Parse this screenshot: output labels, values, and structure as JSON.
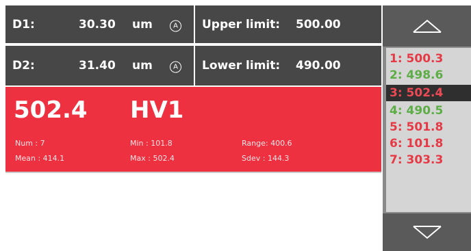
{
  "measurements": {
    "d1": {
      "label": "D1:",
      "value": "30.30",
      "unit": "um",
      "mode_icon": "A"
    },
    "d2": {
      "label": "D2:",
      "value": "31.40",
      "unit": "um",
      "mode_icon": "A"
    },
    "upper_limit": {
      "label": "Upper limit:",
      "value": "500.00"
    },
    "lower_limit": {
      "label": "Lower limit:",
      "value": "490.00"
    }
  },
  "result": {
    "value": "502.4",
    "scale": "HV1",
    "status_color": "#ee3140",
    "stats": {
      "num": "Num  : 7",
      "mean": "Mean : 414.1",
      "min": "Min  : 101.8",
      "max": "Max  : 502.4",
      "range": "Range: 400.6",
      "sdev": "Sdev : 144.3"
    }
  },
  "history": {
    "scroll_up_icon": "chevron-up-icon",
    "scroll_down_icon": "chevron-down-icon",
    "items": [
      {
        "text": "1: 500.3",
        "status": "red"
      },
      {
        "text": "2: 498.6",
        "status": "green"
      },
      {
        "text": "3: 502.4",
        "status": "red",
        "selected": true
      },
      {
        "text": "4: 490.5",
        "status": "green"
      },
      {
        "text": "5: 501.8",
        "status": "red"
      },
      {
        "text": "6: 101.8",
        "status": "red"
      },
      {
        "text": "7: 303.3",
        "status": "red"
      }
    ]
  }
}
